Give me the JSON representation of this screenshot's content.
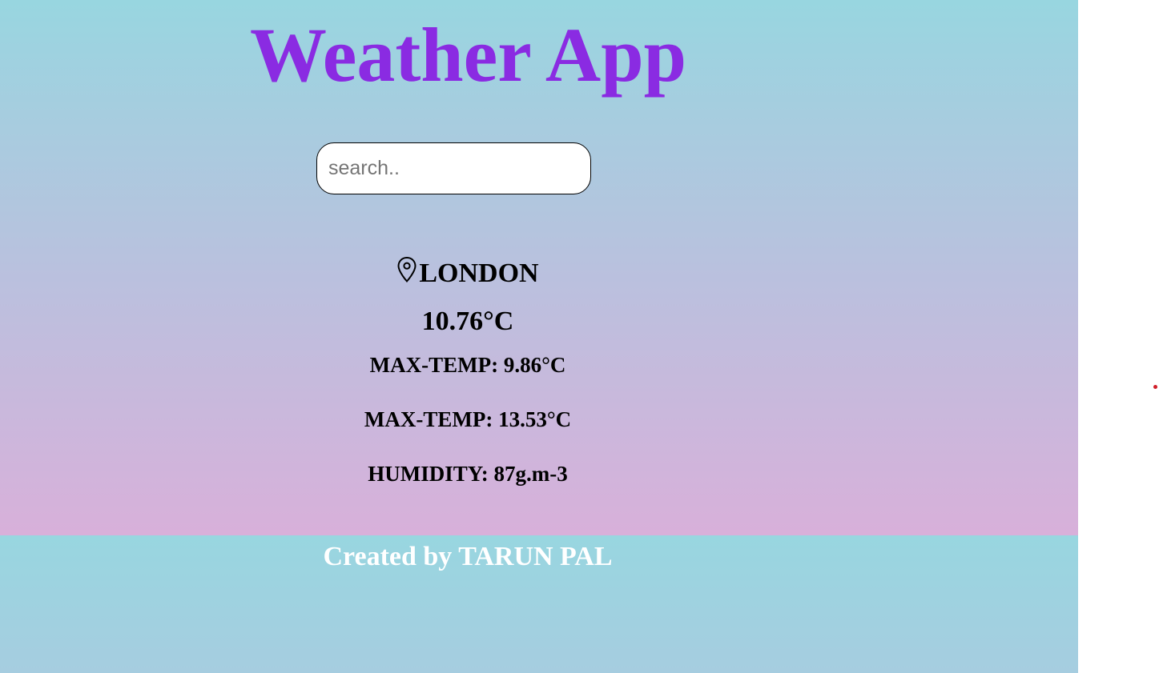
{
  "colors": {
    "title": "#8a2be2",
    "credit": "#ffffff",
    "cursor_dot": "#d0202a"
  },
  "header": {
    "title": "Weather App"
  },
  "search": {
    "placeholder": "search..",
    "value": ""
  },
  "weather": {
    "location_icon": "map-pin-icon",
    "city": "LONDON",
    "temperature": "10.76°C",
    "min_temp": "MAX-TEMP: 9.86°C",
    "max_temp": "MAX-TEMP: 13.53°C",
    "humidity": "HUMIDITY: 87g.m-3"
  },
  "footer": {
    "credit": "Created by TARUN PAL"
  }
}
